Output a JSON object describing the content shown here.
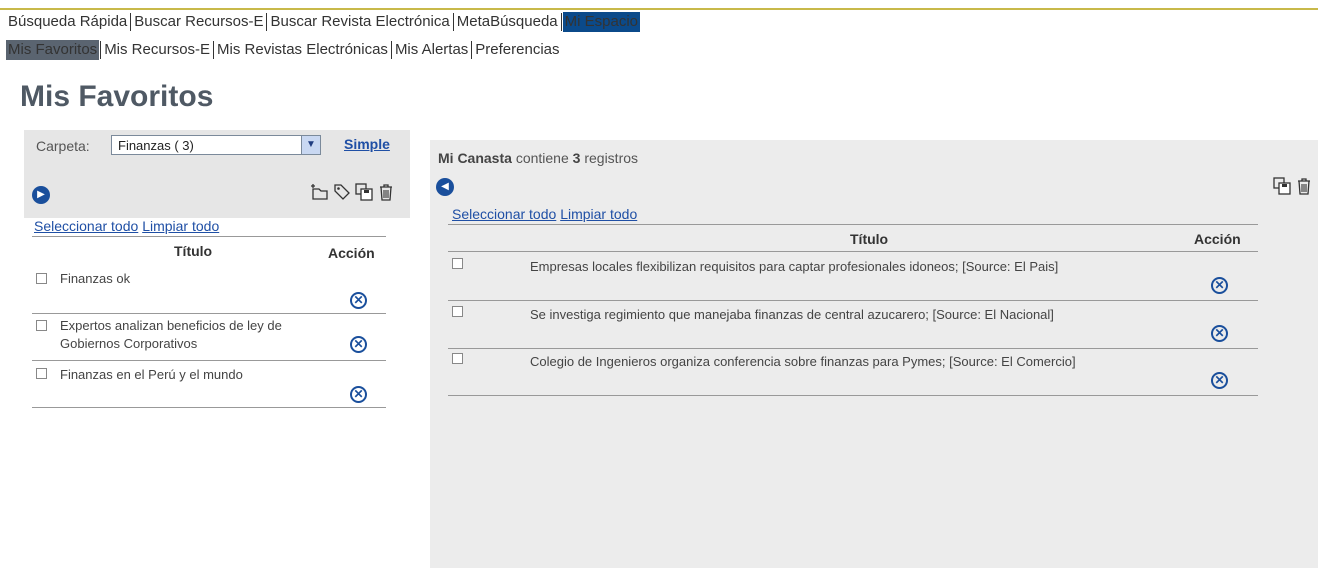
{
  "nav_primary": {
    "items": [
      "Búsqueda Rápida",
      "Buscar Recursos-E",
      "Buscar Revista Electrónica",
      "MetaBúsqueda",
      "Mi Espacio"
    ],
    "active": "Mi Espacio"
  },
  "nav_secondary": {
    "items": [
      "Mis Favoritos",
      "Mis Recursos-E",
      "Mis Revistas Electrónicas",
      "Mis Alertas",
      "Preferencias"
    ],
    "active": "Mis Favoritos"
  },
  "page": {
    "title": "Mis Favoritos"
  },
  "left": {
    "folder_label": "Carpeta:",
    "folder_value": "Finanzas ( 3)",
    "simple_link": "Simple",
    "select_all": "Seleccionar todo",
    "clear_all": "Limpiar todo",
    "col_title": "Título",
    "col_action": "Acción",
    "rows": [
      {
        "text": "Finanzas ok"
      },
      {
        "text": "Expertos analizan beneficios de ley de Gobiernos Corporativos"
      },
      {
        "text": "Finanzas en el Perú y el mundo"
      }
    ],
    "icons": [
      "arrow-icon",
      "new-folder-icon",
      "tag-icon",
      "save-icon",
      "trash-icon"
    ]
  },
  "basket": {
    "name": "Mi Canasta",
    "contains": "contiene",
    "count": "3",
    "records": "registros",
    "select_all": "Seleccionar todo",
    "clear_all": "Limpiar todo",
    "col_title": "Título",
    "col_action": "Acción",
    "rows": [
      {
        "text": "Empresas locales flexibilizan requisitos para captar profesionales idoneos; [Source: El Pais]"
      },
      {
        "text": "Se investiga regimiento que manejaba finanzas de central azucarero; [Source: El Nacional]"
      },
      {
        "text": "Colegio de Ingenieros organiza conferencia sobre finanzas para Pymes; [Source: El Comercio]"
      }
    ],
    "icons": [
      "arrow-left-icon",
      "save-icon",
      "trash-icon"
    ]
  }
}
